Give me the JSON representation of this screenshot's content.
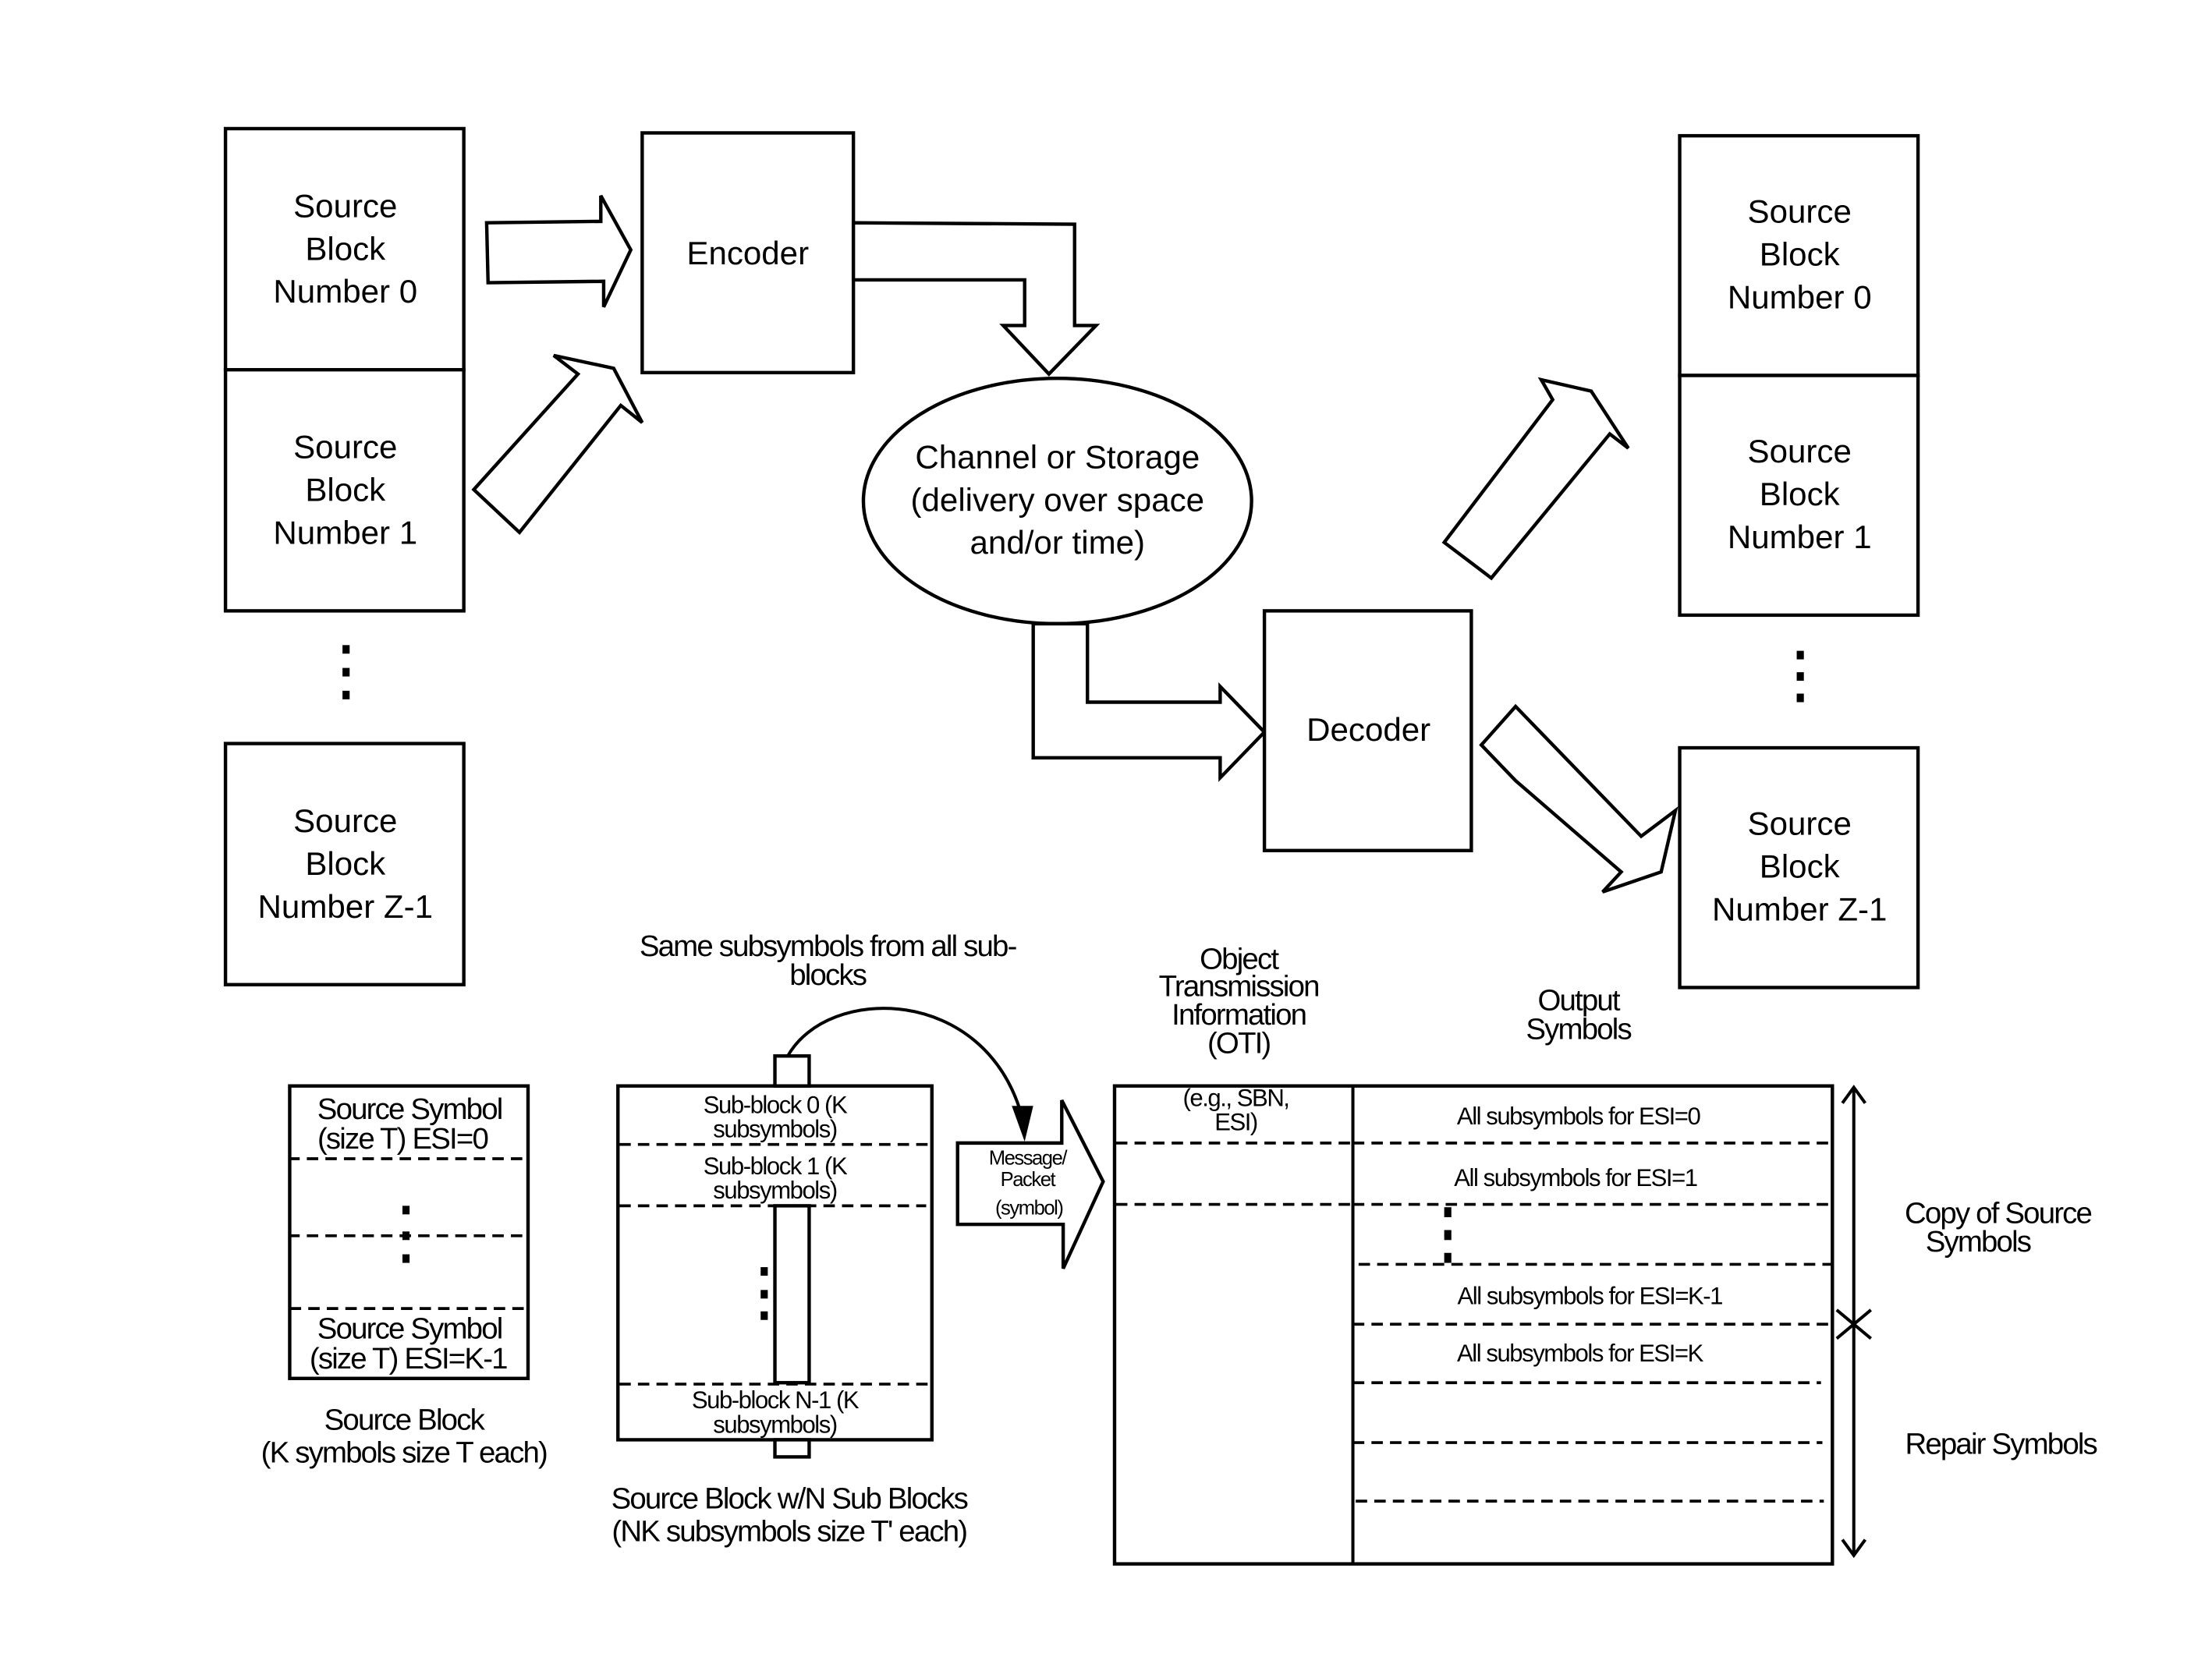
{
  "top": {
    "source_blocks_left": [
      {
        "line1": "Source",
        "line2": "Block",
        "line3": "Number 0"
      },
      {
        "line1": "Source",
        "line2": "Block",
        "line3": "Number 1"
      },
      {
        "line1": "Source",
        "line2": "Block",
        "line3": "Number Z-1"
      }
    ],
    "encoder_label": "Encoder",
    "channel": {
      "line1": "Channel or Storage",
      "line2": "(delivery over space",
      "line3": "and/or time)"
    },
    "decoder_label": "Decoder",
    "source_blocks_right": [
      {
        "line1": "Source",
        "line2": "Block",
        "line3": "Number 0"
      },
      {
        "line1": "Source",
        "line2": "Block",
        "line3": "Number 1"
      },
      {
        "line1": "Source",
        "line2": "Block",
        "line3": "Number Z-1"
      }
    ]
  },
  "bottom": {
    "source_block": {
      "first_symbol_line1": "Source Symbol",
      "first_symbol_line2": "(size T) ESI=0",
      "last_symbol_line1": "Source Symbol",
      "last_symbol_line2": "(size T) ESI=K-1",
      "caption_line1": "Source Block",
      "caption_line2": "(K symbols size T each)"
    },
    "sub_blocks": {
      "heading_line1": "Same subsymbols from all sub-",
      "heading_line2": "blocks",
      "rows": [
        {
          "line1": "Sub-block 0 (K",
          "line2": "subsymbols)"
        },
        {
          "line1": "Sub-block 1 (K",
          "line2": "subsymbols)"
        },
        {
          "line1": "Sub-block N-1 (K",
          "line2": "subsymbols)"
        }
      ],
      "caption_line1": "Source Block w/N Sub Blocks",
      "caption_line2": "(NK subsymbols size T' each)"
    },
    "message_arrow": {
      "line1": "Message/",
      "line2": "Packet",
      "line3": "(symbol)"
    },
    "oti": {
      "heading_line1": "Object",
      "heading_line2": "Transmission",
      "heading_line3": "Information",
      "heading_line4": "(OTI)",
      "cell_line1": "(e.g., SBN,",
      "cell_line2": "ESI)"
    },
    "output_symbols": {
      "heading_line1": "Output",
      "heading_line2": "Symbols",
      "rows": [
        "All subsymbols for ESI=0",
        "All subsymbols for ESI=1",
        "All subsymbols for ESI=K-1",
        "All subsymbols for ESI=K"
      ]
    },
    "brackets": {
      "copy_line1": "Copy of Source",
      "copy_line2": "Symbols",
      "repair": "Repair Symbols"
    }
  }
}
